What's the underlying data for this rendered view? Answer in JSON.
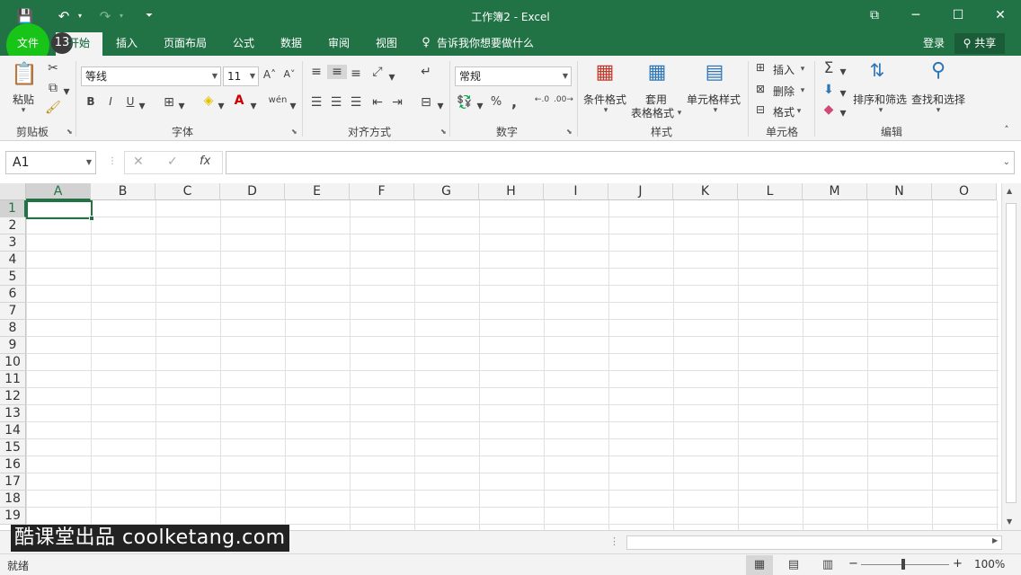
{
  "titlebar": {
    "title": "工作簿2 - Excel",
    "save_icon": "💾",
    "undo_icon": "↶",
    "redo_icon": "↷",
    "customize_icon": "⏷",
    "ribbon_display_icon": "⧉",
    "minimize": "─",
    "maximize": "☐",
    "close": "✕"
  },
  "tabs": [
    "文件",
    "开始",
    "插入",
    "页面布局",
    "公式",
    "数据",
    "审阅",
    "视图"
  ],
  "tell_me": "告诉我你想要做什么",
  "login": "登录",
  "share": "共享",
  "step_badge": "13",
  "ribbon": {
    "clipboard": {
      "label": "剪贴板",
      "paste": "粘贴"
    },
    "font": {
      "label": "字体",
      "name": "等线",
      "size": "11",
      "bold": "B",
      "italic": "I",
      "underline": "U",
      "grow": "A˄",
      "shrink": "A˅",
      "phonetic": "wén"
    },
    "alignment": {
      "label": "对齐方式"
    },
    "number": {
      "label": "数字",
      "format": "常规",
      "percent": "%",
      "comma": ","
    },
    "styles": {
      "label": "样式",
      "conditional": "条件格式",
      "table_line1": "套用",
      "table_line2": "表格格式",
      "cell_styles": "单元格样式"
    },
    "cells": {
      "label": "单元格",
      "insert": "插入",
      "delete": "删除",
      "format": "格式"
    },
    "editing": {
      "label": "编辑",
      "sort": "排序和筛选",
      "find": "查找和选择",
      "sum": "Σ"
    }
  },
  "formula_bar": {
    "name_box": "A1",
    "cancel": "✕",
    "confirm": "✓",
    "fx": "fx"
  },
  "columns": [
    "A",
    "B",
    "C",
    "D",
    "E",
    "F",
    "G",
    "H",
    "I",
    "J",
    "K",
    "L",
    "M",
    "N",
    "O"
  ],
  "rows": [
    "1",
    "2",
    "3",
    "4",
    "5",
    "6",
    "7",
    "8",
    "9",
    "10",
    "11",
    "12",
    "13",
    "14",
    "15",
    "16",
    "17",
    "18",
    "19"
  ],
  "watermark": "酷课堂出品 coolketang.com",
  "status": {
    "ready": "就绪",
    "zoom": "100%"
  },
  "colors": {
    "accent": "#217346",
    "highlight": "#17c417"
  }
}
